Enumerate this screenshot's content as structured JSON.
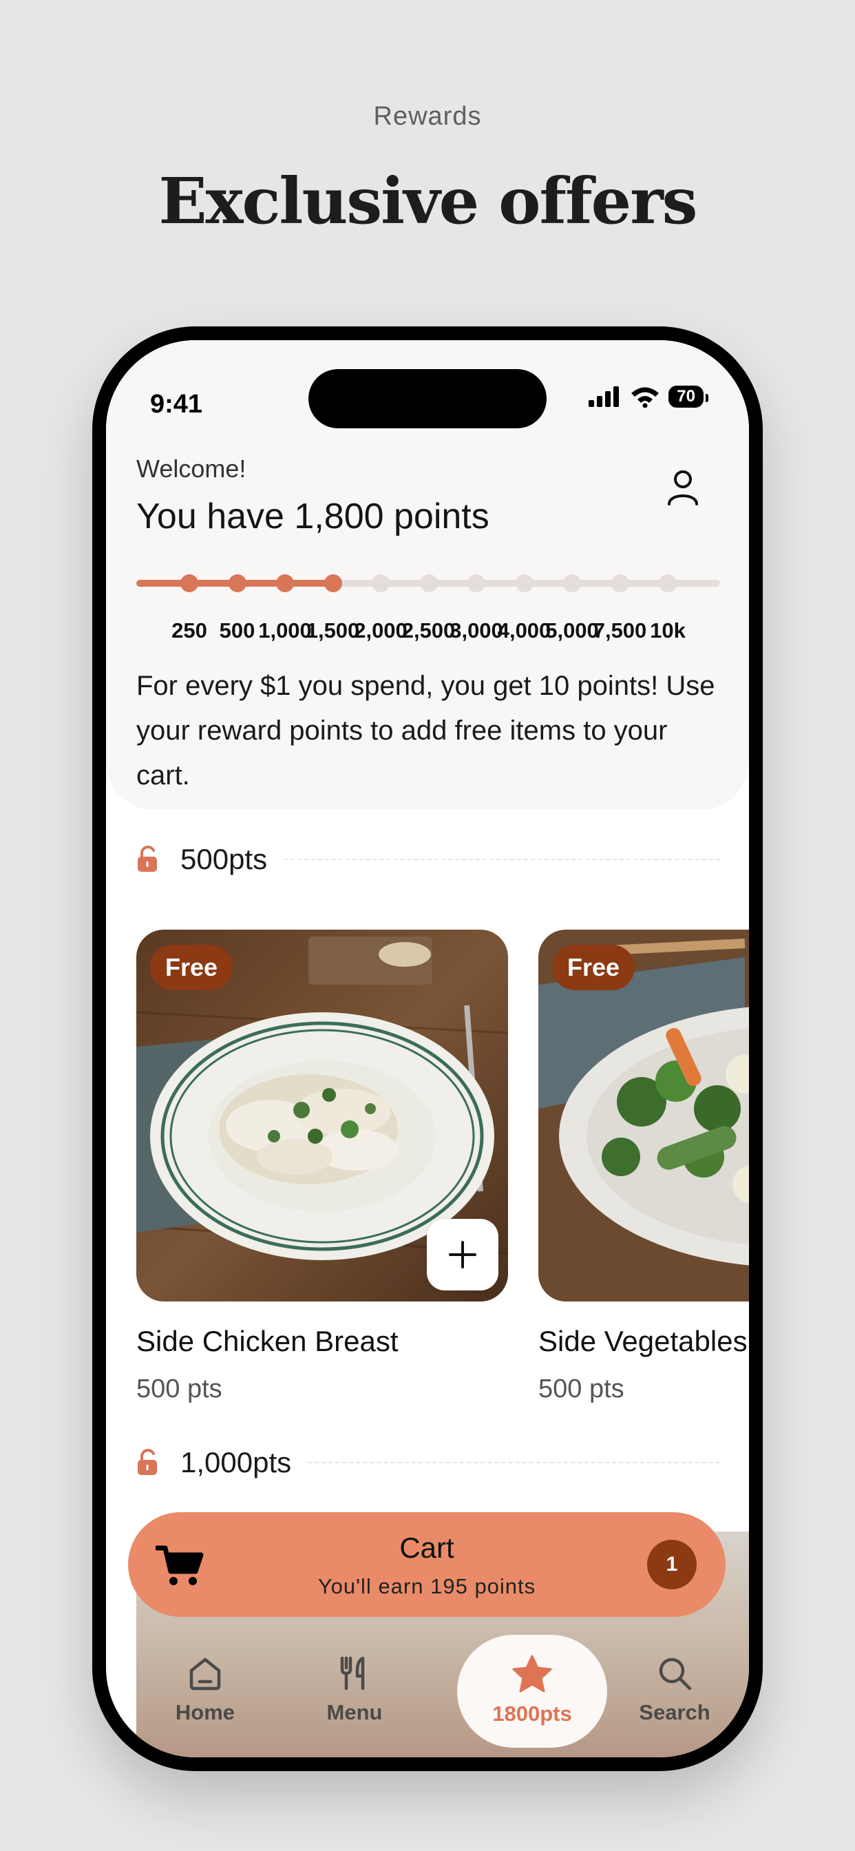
{
  "page": {
    "caption": "Rewards",
    "headline": "Exclusive offers"
  },
  "status_bar": {
    "time": "9:41",
    "battery": "70"
  },
  "header": {
    "welcome": "Welcome!",
    "points_title": "You have 1,800 points",
    "progress": {
      "current_points": 1800,
      "filled_milestones": 4,
      "milestones": [
        "250",
        "500",
        "1,000",
        "1,500",
        "2,000",
        "2,500",
        "3,000",
        "4,000",
        "5,000",
        "7,500",
        "10k"
      ]
    },
    "info_text": "For every $1 you spend, you get 10 points! Use your reward points to add free items to your cart."
  },
  "sections": [
    {
      "label": "500pts",
      "items": [
        {
          "badge": "Free",
          "name": "Side Chicken Breast",
          "points": "500 pts"
        },
        {
          "badge": "Free",
          "name": "Side Vegetables",
          "points": "500 pts"
        }
      ]
    },
    {
      "label": "1,000pts"
    }
  ],
  "cart": {
    "title": "Cart",
    "subtitle": "You'll earn 195 points",
    "count": "1"
  },
  "tabbar": {
    "tabs": [
      {
        "label": "Home",
        "icon": "home-icon"
      },
      {
        "label": "Menu",
        "icon": "utensils-icon"
      },
      {
        "label": "1800pts",
        "icon": "star-icon",
        "active": true
      },
      {
        "label": "Search",
        "icon": "search-icon"
      }
    ]
  },
  "colors": {
    "accent": "#d87657",
    "cart": "#e98b68",
    "badge": "#8c3a14",
    "background": "#e6e6e6"
  }
}
